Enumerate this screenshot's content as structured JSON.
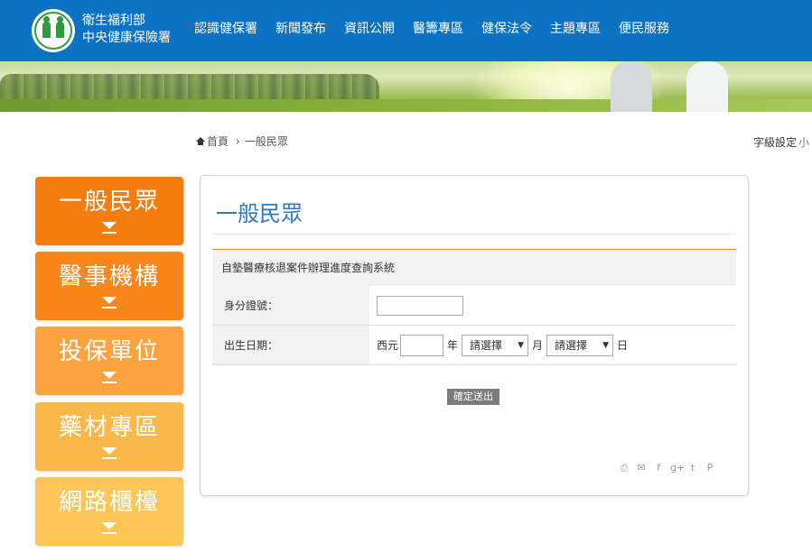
{
  "header": {
    "org_line1": "衛生福利部",
    "org_line2": "中央健康保險署",
    "nav": [
      {
        "label": "認識健保署"
      },
      {
        "label": "新聞發布"
      },
      {
        "label": "資訊公開"
      },
      {
        "label": "醫籌專區"
      },
      {
        "label": "健保法令"
      },
      {
        "label": "主題專區"
      },
      {
        "label": "便民服務"
      }
    ]
  },
  "breadcrumb": {
    "home": "首頁",
    "sep": "›",
    "current": "一般民眾"
  },
  "font_size": {
    "label": "字級設定",
    "value": "小"
  },
  "sidebar": {
    "items": [
      {
        "label": "一般民眾",
        "color": "#f57d0f"
      },
      {
        "label": "醫事機構",
        "color": "#f8861a"
      },
      {
        "label": "投保單位",
        "color": "#fba340"
      },
      {
        "label": "藥材專區",
        "color": "#fbb84a"
      },
      {
        "label": "網路櫃檯",
        "color": "#fcc558"
      }
    ]
  },
  "panel": {
    "title": "一般民眾",
    "form_title": "自墊醫療核退案件辦理進度查詢系統",
    "id_label": "身分證號：",
    "dob_label": "出生日期：",
    "era": "西元",
    "year_unit": "年",
    "month_unit": "月",
    "day_unit": "日",
    "month_select": "請選擇",
    "day_select": "請選擇",
    "caret": "▼",
    "submit": "確定送出"
  },
  "share_icons": [
    {
      "name": "print-icon",
      "glyph": "⎙"
    },
    {
      "name": "email-icon",
      "glyph": "✉"
    },
    {
      "name": "facebook-icon",
      "glyph": "f"
    },
    {
      "name": "googleplus-icon",
      "glyph": "g+"
    },
    {
      "name": "twitter-icon",
      "glyph": "t"
    },
    {
      "name": "plurk-icon",
      "glyph": "P"
    }
  ]
}
